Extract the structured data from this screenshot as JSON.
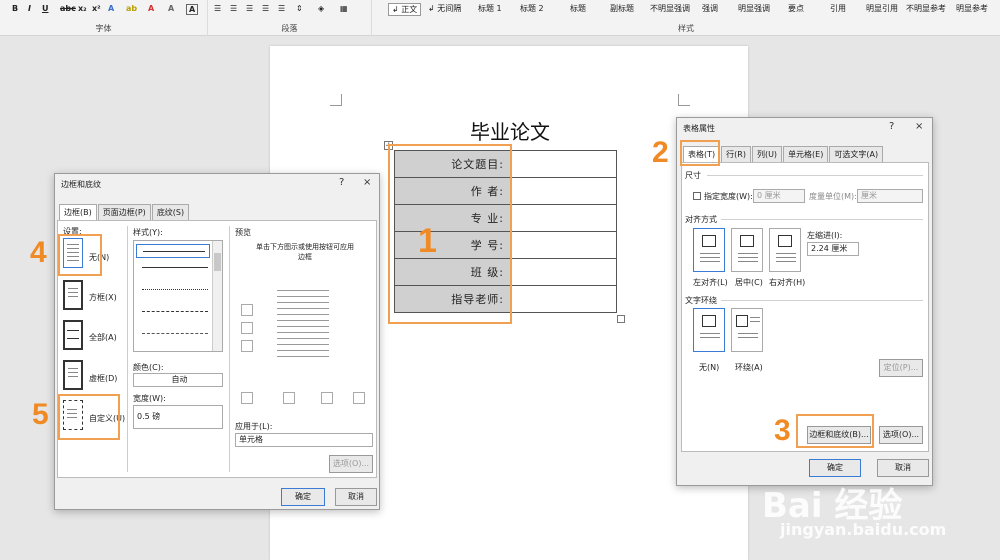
{
  "ribbon": {
    "font_group": "字体",
    "paragraph_group": "段落",
    "style_group": "样式",
    "format_buttons": [
      "B",
      "I",
      "U",
      "abc",
      "x₂",
      "x²",
      "A",
      "A",
      "A"
    ],
    "styles": [
      "↲ 正文",
      "↲ 无间隔",
      "标题 1",
      "标题 2",
      "标题",
      "副标题",
      "不明显强调",
      "强调",
      "明显强调",
      "要点",
      "引用",
      "明显引用",
      "不明显参考",
      "明显参考"
    ]
  },
  "document": {
    "title": "毕业论文",
    "rows": [
      "论文题目:",
      "作    者:",
      "专    业:",
      "学    号:",
      "班    级:",
      "指导老师:"
    ]
  },
  "annotations": {
    "n1": "1",
    "n2": "2",
    "n3": "3",
    "n4": "4",
    "n5": "5"
  },
  "table_props": {
    "title": "表格属性",
    "help": "?",
    "close": "×",
    "tabs": [
      "表格(T)",
      "行(R)",
      "列(U)",
      "单元格(E)",
      "可选文字(A)"
    ],
    "size_section": "尺寸",
    "preferred_width_label": "指定宽度(W):",
    "width_value": "0 厘米",
    "unit_label": "度量单位(M):",
    "unit_value": "厘米",
    "align_section": "对齐方式",
    "indent_label": "左缩进(I):",
    "indent_value": "2.24 厘米",
    "align_options": [
      "左对齐(L)",
      "居中(C)",
      "右对齐(H)"
    ],
    "wrap_section": "文字环绕",
    "wrap_options": [
      "无(N)",
      "环绕(A)"
    ],
    "position_button": "定位(P)...",
    "borders_button": "边框和底纹(B)...",
    "options_button": "选项(O)...",
    "ok_button": "确定",
    "cancel_button": "取消"
  },
  "borders_dialog": {
    "title": "边框和底纹",
    "help": "?",
    "close": "×",
    "tabs": [
      "边框(B)",
      "页面边框(P)",
      "底纹(S)"
    ],
    "settings_label": "设置:",
    "settings": [
      "无(N)",
      "方框(X)",
      "全部(A)",
      "虚框(D)",
      "自定义(U)"
    ],
    "style_label": "样式(Y):",
    "color_label": "颜色(C):",
    "color_value": "自动",
    "width_label": "宽度(W):",
    "width_value": "0.5 磅",
    "preview_label": "预览",
    "preview_hint": "单击下方图示或使用按钮可应用边框",
    "apply_label": "应用于(L):",
    "apply_value": "单元格",
    "options_button": "选项(O)...",
    "ok_button": "确定",
    "cancel_button": "取消"
  },
  "watermark": {
    "brand": "Bai  经验",
    "url": "jingyan.baidu.com"
  }
}
